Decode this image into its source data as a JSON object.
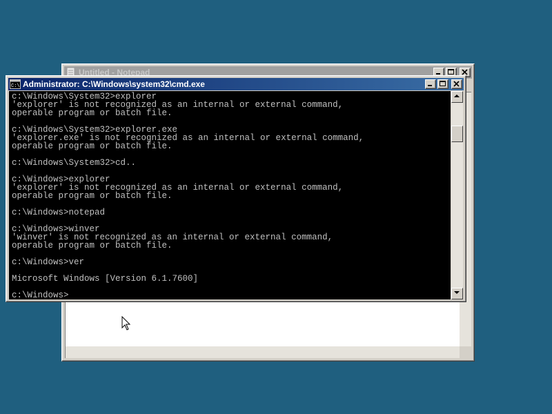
{
  "desktop": {
    "background_color": "#1f5f7f"
  },
  "notepad_window": {
    "title": "Untitled - Notepad",
    "active": false,
    "content": ""
  },
  "cmd_window": {
    "title": "Administrator: C:\\Windows\\system32\\cmd.exe",
    "active": true,
    "icon": "cmd-icon",
    "console_text": "c:\\Windows\\System32>explorer\n'explorer' is not recognized as an internal or external command,\noperable program or batch file.\n\nc:\\Windows\\System32>explorer.exe\n'explorer.exe' is not recognized as an internal or external command,\noperable program or batch file.\n\nc:\\Windows\\System32>cd..\n\nc:\\Windows>explorer\n'explorer' is not recognized as an internal or external command,\noperable program or batch file.\n\nc:\\Windows>notepad\n\nc:\\Windows>winver\n'winver' is not recognized as an internal or external command,\noperable program or batch file.\n\nc:\\Windows>ver\n\nMicrosoft Windows [Version 6.1.7600]\n\nc:\\Windows>",
    "console_bg": "#000000",
    "console_fg": "#c0c0c0"
  },
  "window_buttons": [
    "minimize-icon",
    "maximize-icon",
    "close-icon"
  ],
  "mouse_pointer": {
    "icon": "arrow-cursor-icon"
  }
}
